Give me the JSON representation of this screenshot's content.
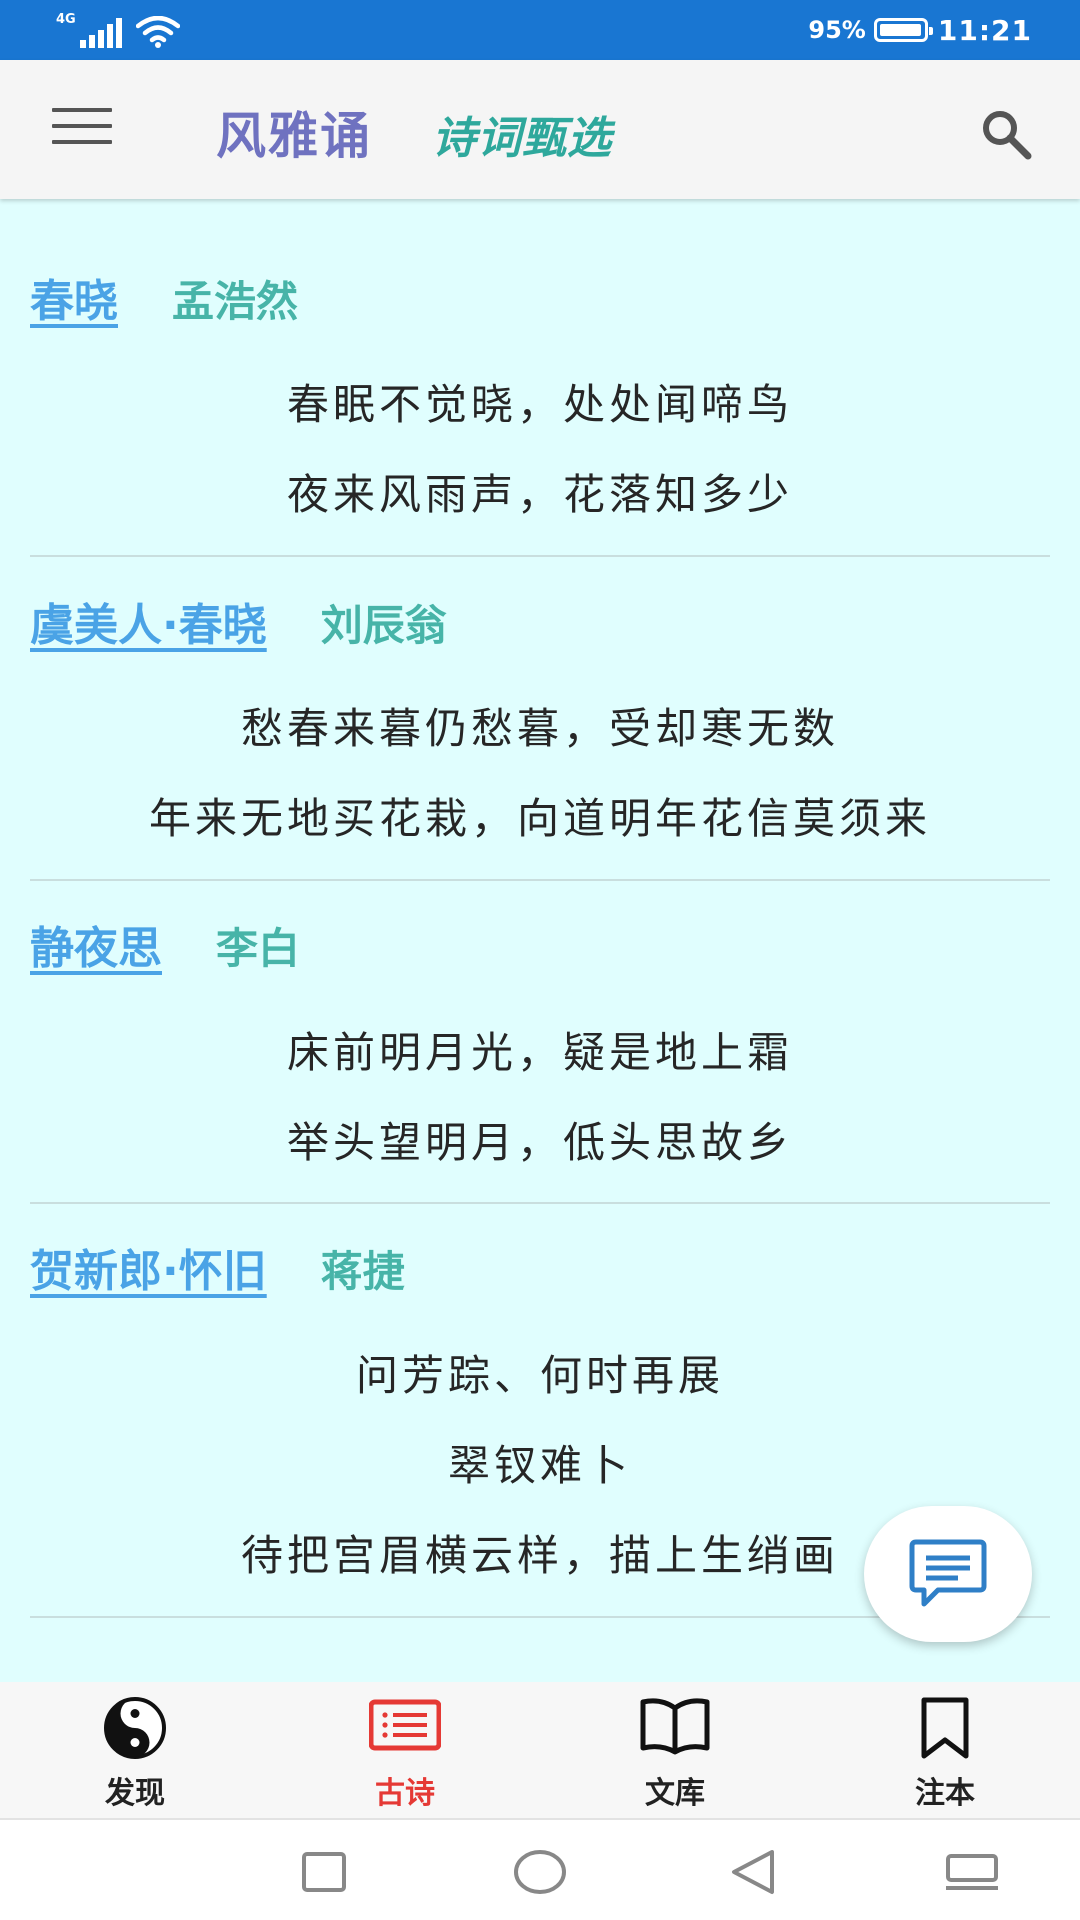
{
  "status_bar": {
    "network": "4G",
    "battery": "95%",
    "time": "11:21"
  },
  "app_bar": {
    "title": "风雅诵",
    "subtitle": "诗词甄选"
  },
  "poems": [
    {
      "title": "春晓",
      "author": "孟浩然",
      "lines": [
        "春眠不觉晓，处处闻啼鸟",
        "夜来风雨声，花落知多少"
      ]
    },
    {
      "title": "虞美人·春晓",
      "author": "刘辰翁",
      "lines": [
        "愁春来暮仍愁暮，受却寒无数",
        "年来无地买花栽，向道明年花信莫须来"
      ]
    },
    {
      "title": "静夜思",
      "author": "李白",
      "lines": [
        "床前明月光，疑是地上霜",
        "举头望明月，低头思故乡"
      ]
    },
    {
      "title": "贺新郎·怀旧",
      "author": "蒋捷",
      "lines": [
        "问芳踪、何时再展",
        "翠钗难卜",
        "待把宫眉横云样，描上生绡画"
      ]
    }
  ],
  "tabs": [
    {
      "label": "发现",
      "icon": "yin-yang-icon",
      "active": false
    },
    {
      "label": "古诗",
      "icon": "list-icon",
      "active": true
    },
    {
      "label": "文库",
      "icon": "book-icon",
      "active": false
    },
    {
      "label": "注本",
      "icon": "bookmark-icon",
      "active": false
    }
  ],
  "colors": {
    "status_bar": "#1976d2",
    "title": "#6f72c0",
    "subtitle": "#2ea89c",
    "poem_title": "#4aa3e6",
    "poem_author": "#47b4a8",
    "content_bg": "#e0fefe",
    "active_tab": "#e53935"
  }
}
